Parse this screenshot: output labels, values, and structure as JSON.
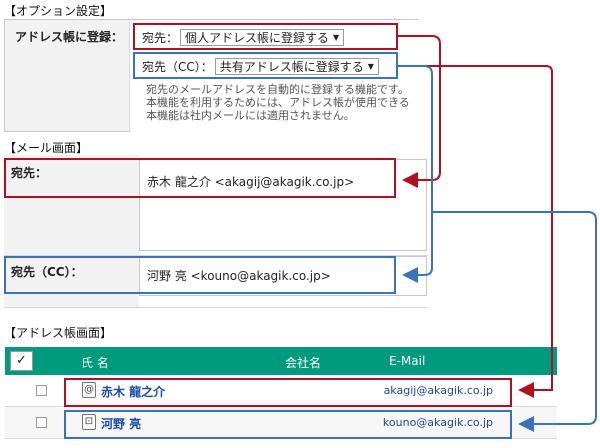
{
  "option_section": {
    "title": "【オプション設定】",
    "label": "アドレス帳に登録：",
    "to_row": {
      "label": "宛先：",
      "selected": "個人アドレス帳に登録する"
    },
    "cc_row": {
      "label": "宛先（CC）：",
      "selected": "共有アドレス帳に登録する"
    },
    "description": [
      "宛先のメールアドレスを自動的に登録する機能です。",
      "本機能を利用するためには、アドレス帳が使用できる",
      "本機能は社内メールには適用されません。"
    ]
  },
  "mail_section": {
    "title": "【メール画面】",
    "to_label": "宛先：",
    "to_value": "赤木 龍之介 <akagij@akagik.co.jp>",
    "cc_label": "宛先（CC）：",
    "cc_value": "河野 亮 <kouno@akagik.co.jp>"
  },
  "addressbook_section": {
    "title": "【アドレス帳画面】",
    "columns": {
      "check": "✓",
      "name": "氏 名",
      "company": "会社名",
      "email": "E-Mail"
    },
    "rows": [
      {
        "icon": "@",
        "name": "赤木 龍之介",
        "email": "akagij@akagik.co.jp"
      },
      {
        "icon": "⊡",
        "name": "河野 亮",
        "email": "kouno@akagik.co.jp"
      }
    ]
  },
  "colors": {
    "accent": "#009b7e",
    "highlight_red": "#b01020",
    "highlight_blue": "#3a73b8",
    "link": "#1a4aa6"
  }
}
